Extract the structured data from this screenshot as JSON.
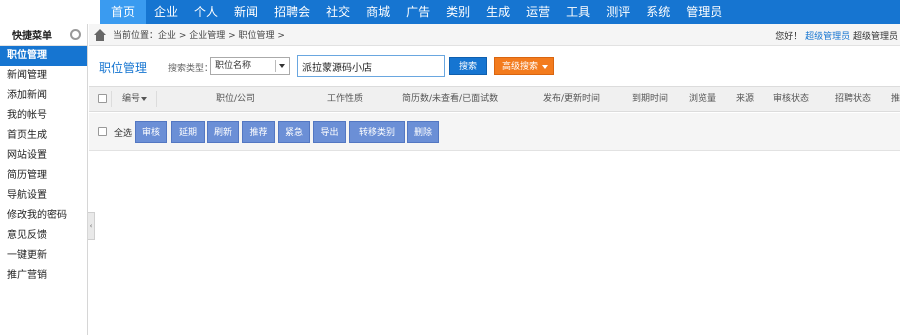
{
  "topnav": {
    "items": [
      "首页",
      "企业",
      "个人",
      "新闻",
      "招聘会",
      "社交",
      "商城",
      "广告",
      "类别",
      "生成",
      "运营",
      "工具",
      "测评",
      "系统",
      "管理员"
    ]
  },
  "sidebar": {
    "title": "快捷菜单",
    "items": [
      "职位管理",
      "新闻管理",
      "添加新闻",
      "我的帐号",
      "首页生成",
      "网站设置",
      "简历管理",
      "导航设置",
      "修改我的密码",
      "意见反馈",
      "一键更新",
      "推广营销"
    ]
  },
  "breadcrumb": {
    "text": "当前位置：企业 > 企业管理 > 职位管理 >",
    "welcome_prefix": "您好！",
    "admin_name": "超级管理员",
    "welcome_suffix": "超级管理员"
  },
  "search": {
    "title": "职位管理",
    "type_label": "搜索类型：",
    "type_value": "职位名称",
    "query": "派拉蒙源码小店",
    "search_button": "搜索",
    "advanced_button": "高级搜索"
  },
  "table": {
    "columns": [
      "编号",
      "职位/公司",
      "工作性质",
      "简历数/未查看/已面试数",
      "发布/更新时间",
      "到期时间",
      "浏览量",
      "来源",
      "审核状态",
      "招聘状态",
      "推"
    ]
  },
  "actions": {
    "select_all": "全选",
    "buttons": [
      "审核",
      "延期",
      "刷新",
      "推荐",
      "紧急",
      "导出",
      "转移类别",
      "删除"
    ]
  },
  "colors": {
    "primary": "#1675d1",
    "accent_orange": "#f37b1d",
    "action_button": "#6b8fd6"
  }
}
